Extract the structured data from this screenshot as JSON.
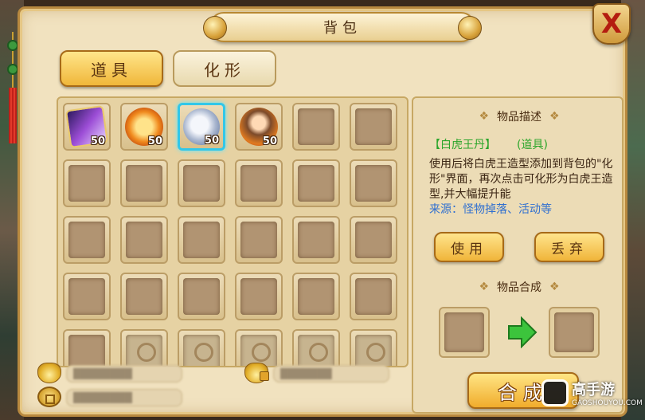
{
  "title": "背包",
  "close_label": "X",
  "tabs": [
    {
      "label": "道具",
      "active": true
    },
    {
      "label": "化形",
      "active": false
    }
  ],
  "inventory": {
    "rows": [
      [
        {
          "art": "art-card",
          "qty": "50",
          "icon": "scroll-card-icon"
        },
        {
          "art": "art-orb",
          "qty": "50",
          "icon": "orb-item-icon"
        },
        {
          "art": "art-tiger",
          "qty": "50",
          "icon": "white-tiger-icon",
          "selected": true
        },
        {
          "art": "art-hero",
          "qty": "50",
          "icon": "hero-portrait-icon"
        },
        {},
        {}
      ],
      [
        {},
        {},
        {},
        {},
        {},
        {}
      ],
      [
        {},
        {},
        {},
        {},
        {},
        {}
      ],
      [
        {},
        {},
        {},
        {},
        {},
        {}
      ],
      [
        {},
        {
          "locked": true
        },
        {
          "locked": true
        },
        {
          "locked": true
        },
        {
          "locked": true
        },
        {
          "locked": true
        }
      ]
    ]
  },
  "currency": {
    "gold_value": "████████",
    "bound_gold_value": "███████",
    "coin_value": "████████"
  },
  "detail": {
    "desc_header": "物品描述",
    "item_name": "【白虎王丹】",
    "item_type": "(道具)",
    "description": "使用后将白虎王造型添加到背包的\"化形\"界面，再次点击可化形为白虎王造型,并大幅提升能",
    "source": "来源：怪物掉落、活动等",
    "use_label": "使用",
    "discard_label": "丢弃",
    "synth_header": "物品合成",
    "synth_label": "合成"
  },
  "watermark": {
    "cn": "高手游",
    "en": "GAOSHOUYOU.COM"
  },
  "colors": {
    "accent_green": "#2aa52a",
    "accent_blue": "#2f6fd0",
    "selected_border": "#32c7e8"
  }
}
